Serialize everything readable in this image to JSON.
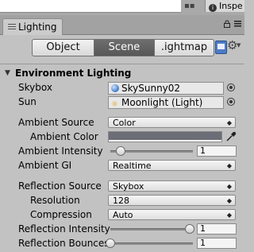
{
  "topbar": {
    "dots": "▪▪",
    "inspector_tab": "Inspe",
    "info_icon_glyph": "i"
  },
  "window": {
    "tab_label": "Lighting",
    "icons": [
      "list-icon",
      "lock-icon",
      "menu-icon"
    ]
  },
  "toolbar": {
    "tabs": [
      {
        "label": "Object",
        "active": false
      },
      {
        "label": "Scene",
        "active": true
      },
      {
        "label": ".ightmap",
        "active": false
      }
    ],
    "icons": [
      "help-book-icon",
      "gear-icon"
    ]
  },
  "environment": {
    "title": "Environment Lighting",
    "skybox": {
      "label": "Skybox",
      "value": "SkySunny02",
      "icon": "material-icon"
    },
    "sun": {
      "label": "Sun",
      "value": "Moonlight (Light)",
      "icon": "light-icon"
    },
    "ambient_source": {
      "label": "Ambient Source",
      "value": "Color"
    },
    "ambient_color": {
      "label": "Ambient Color",
      "color": "#6d6d78"
    },
    "ambient_intensity": {
      "label": "Ambient Intensity",
      "value": "1",
      "slider_fraction": 0.125
    },
    "ambient_gi": {
      "label": "Ambient GI",
      "value": "Realtime"
    },
    "reflection_source": {
      "label": "Reflection Source",
      "value": "Skybox"
    },
    "resolution": {
      "label": "Resolution",
      "value": "128"
    },
    "compression": {
      "label": "Compression",
      "value": "Auto"
    },
    "reflection_intensity": {
      "label": "Reflection Intensity",
      "value": "1",
      "slider_fraction": 1.0
    },
    "reflection_bounces": {
      "label": "Reflection Bounces",
      "value": "1",
      "slider_fraction": 0.0
    }
  },
  "colors": {
    "panel_bg": "#c2c2c2",
    "active_segment": "#5f5f5f"
  }
}
